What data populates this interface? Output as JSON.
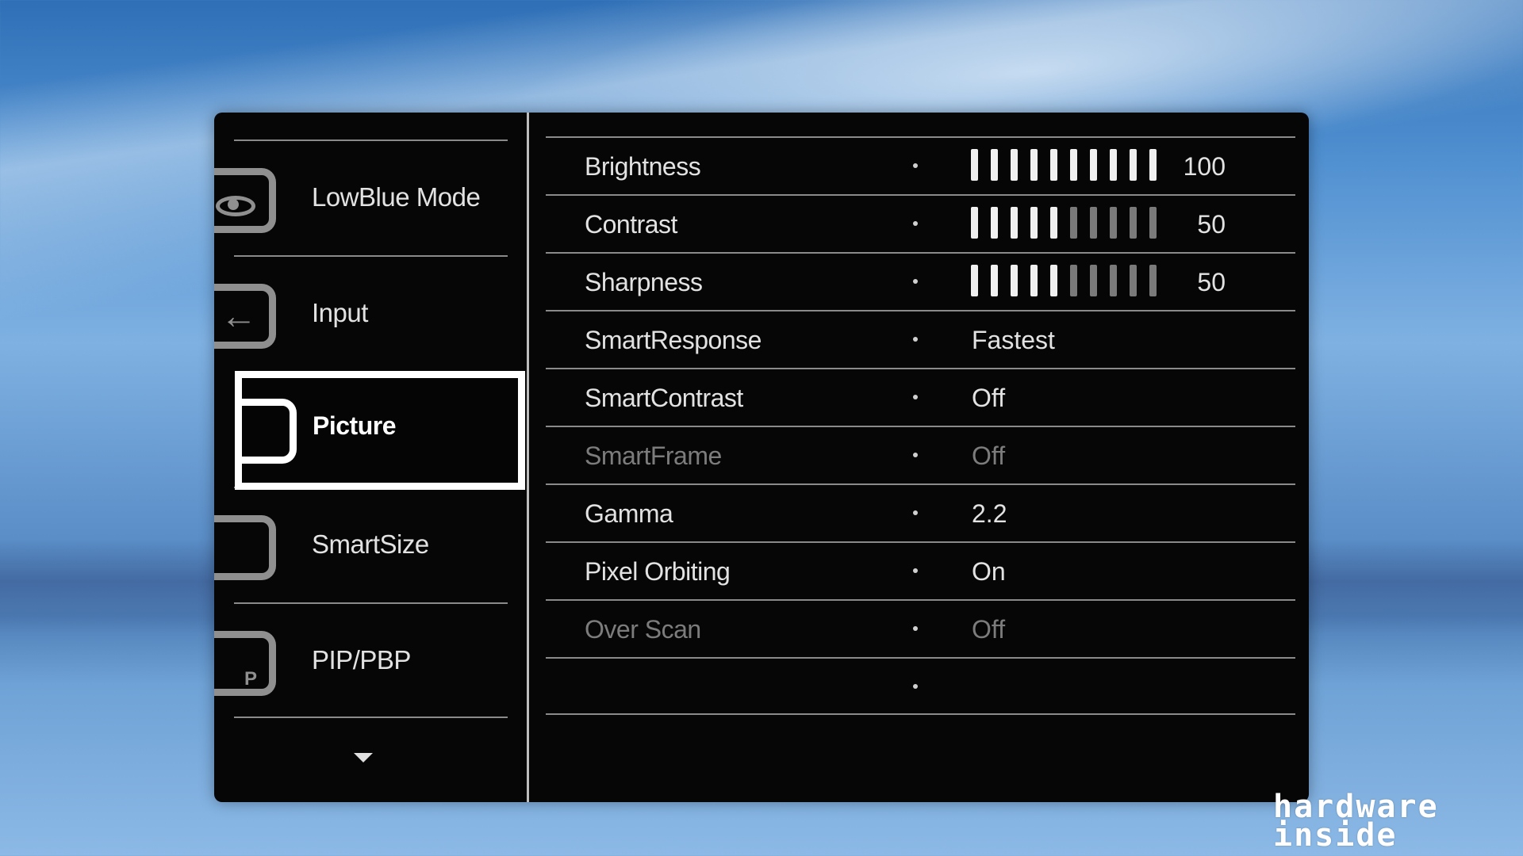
{
  "sidebar": {
    "items": [
      {
        "label": "LowBlue Mode",
        "icon": "eye-icon"
      },
      {
        "label": "Input",
        "icon": "input-arrow-icon"
      },
      {
        "label": "Picture",
        "icon": "picture-icon",
        "active": true
      },
      {
        "label": "SmartSize",
        "icon": "smartsize-icon"
      },
      {
        "label": "PIP/PBP",
        "icon": "pip-icon"
      }
    ],
    "more_icon": "chevron-down-icon"
  },
  "settings": {
    "rows": [
      {
        "label": "Brightness",
        "type": "bar",
        "value": "100",
        "level": 1.0
      },
      {
        "label": "Contrast",
        "type": "bar",
        "value": "50",
        "level": 0.5
      },
      {
        "label": "Sharpness",
        "type": "bar",
        "value": "50",
        "level": 0.5
      },
      {
        "label": "SmartResponse",
        "type": "text",
        "value": "Fastest"
      },
      {
        "label": "SmartContrast",
        "type": "text",
        "value": "Off"
      },
      {
        "label": "SmartFrame",
        "type": "text",
        "value": "Off",
        "disabled": true
      },
      {
        "label": "Gamma",
        "type": "text",
        "value": "2.2"
      },
      {
        "label": "Pixel Orbiting",
        "type": "text",
        "value": "On"
      },
      {
        "label": "Over Scan",
        "type": "text",
        "value": "Off",
        "disabled": true
      },
      {
        "label": "",
        "type": "text",
        "value": ""
      }
    ]
  },
  "watermark": {
    "line1": "hardware",
    "line2": "inside"
  },
  "colors": {
    "osd_bg": "#060606",
    "text": "#e2e2e2",
    "disabled_text": "#7c7c7c",
    "highlight": "#ffffff"
  }
}
